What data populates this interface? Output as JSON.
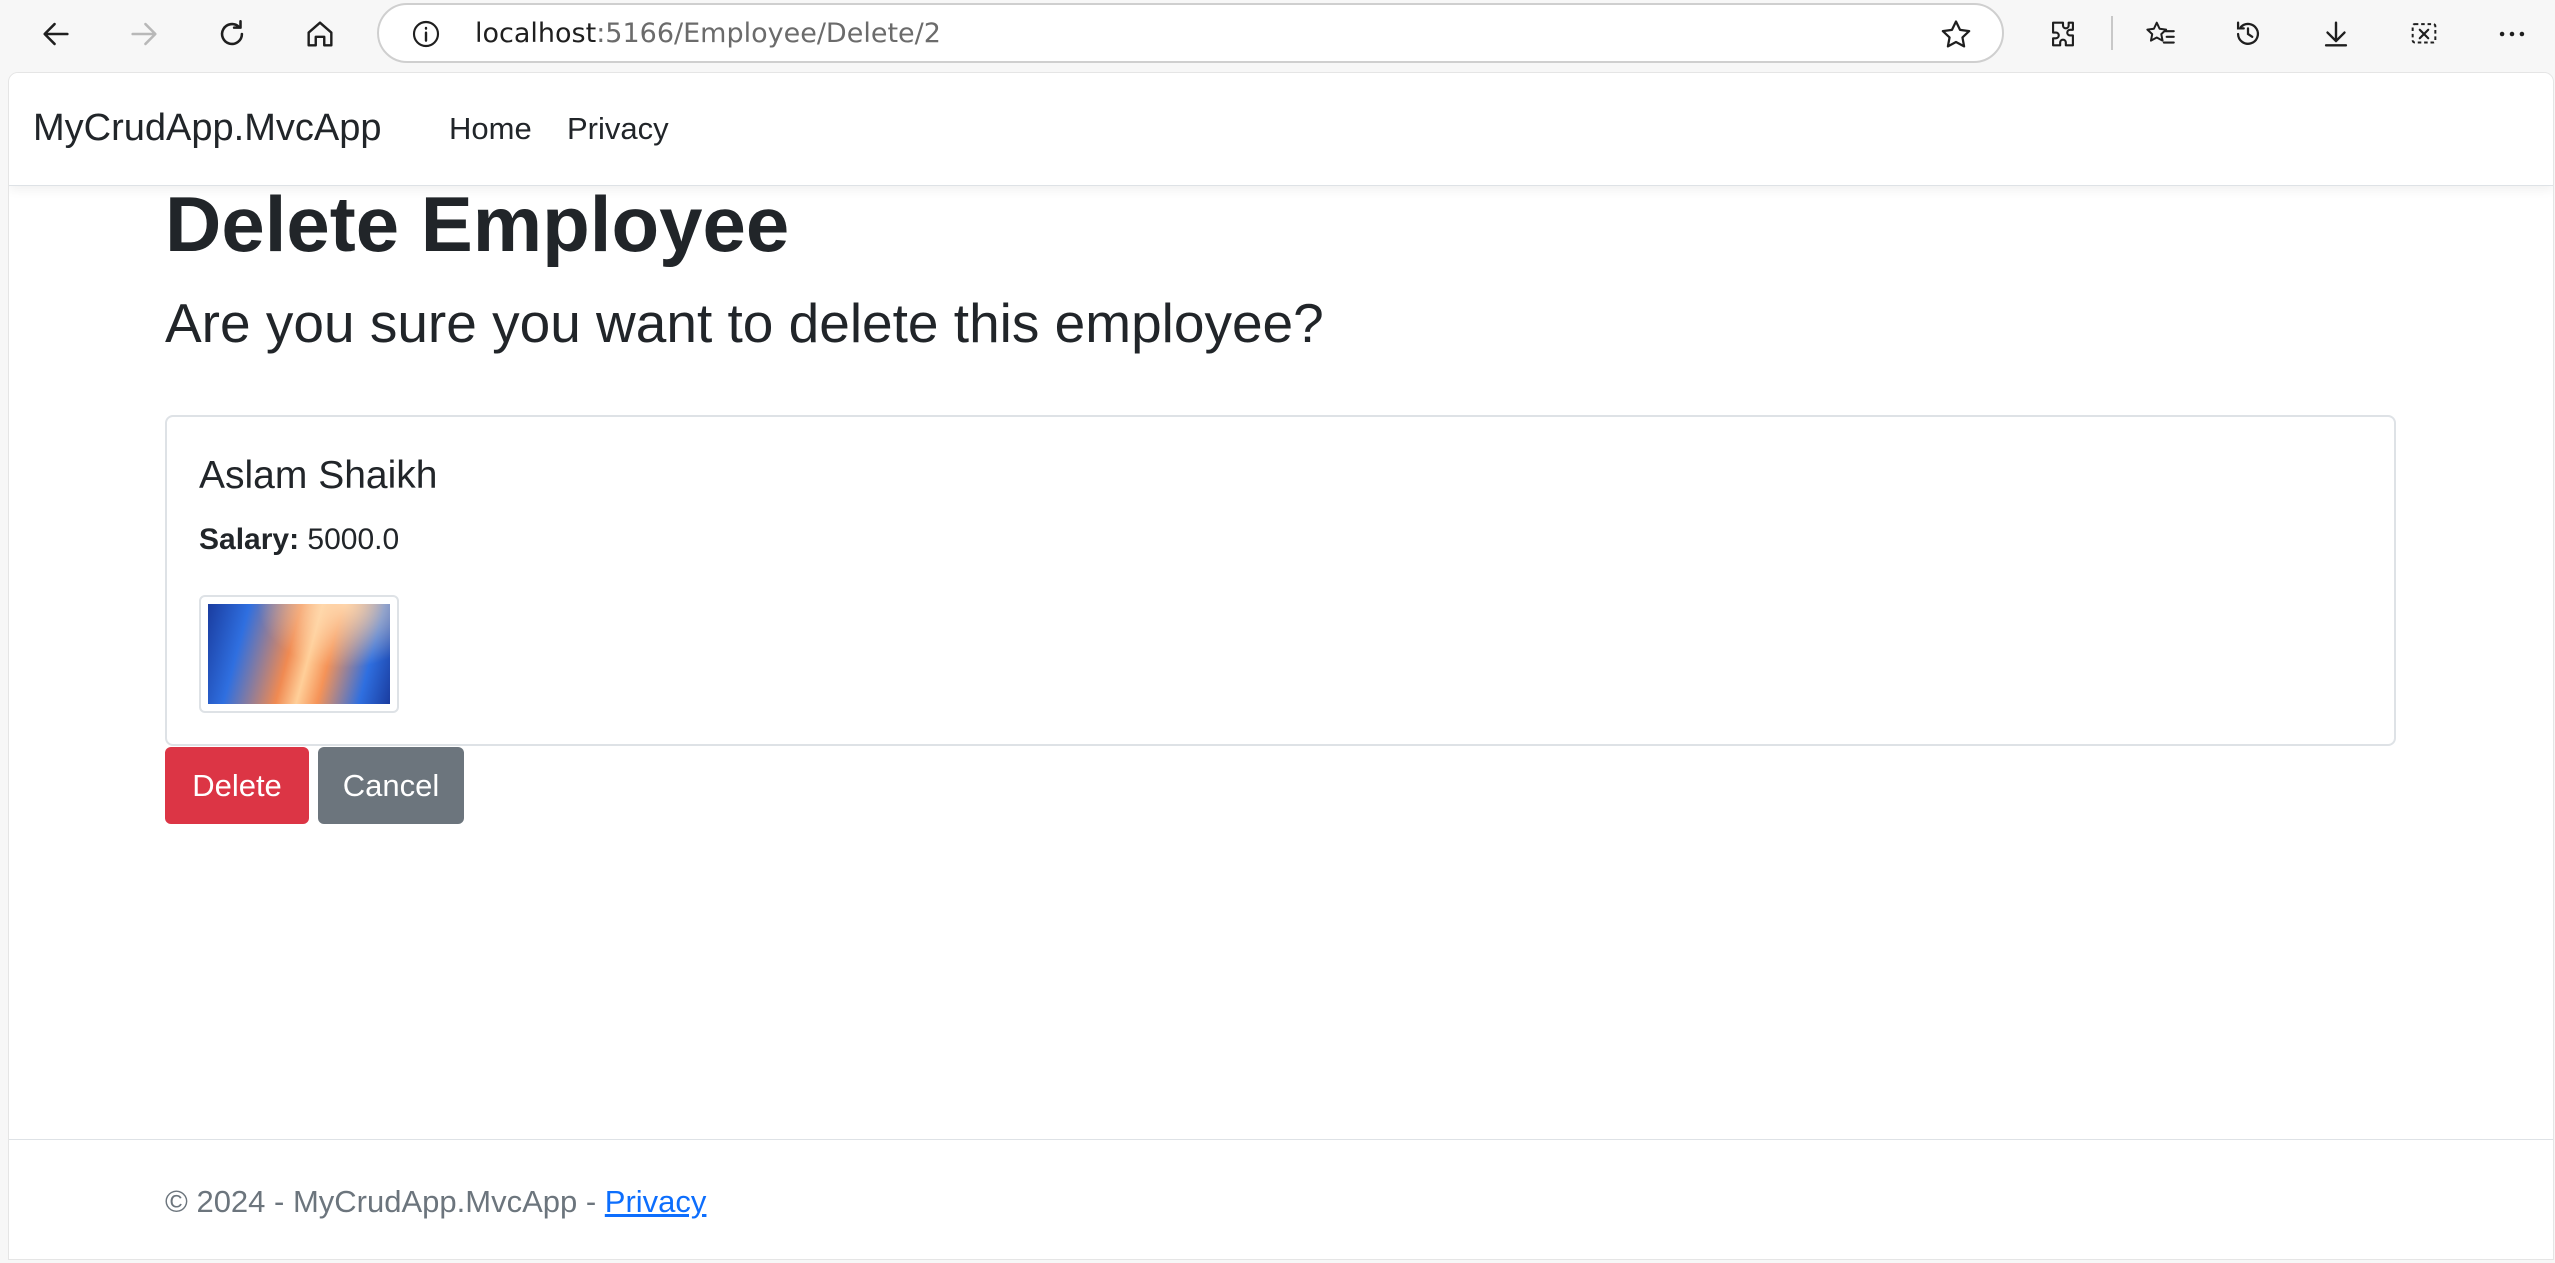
{
  "browser": {
    "url_host": "localhost",
    "url_path": ":5166/Employee/Delete/2"
  },
  "navbar": {
    "brand": "MyCrudApp.MvcApp",
    "links": [
      "Home",
      "Privacy"
    ]
  },
  "main": {
    "title": "Delete Employee",
    "subtitle": "Are you sure you want to delete this employee?",
    "employee": {
      "name": "Aslam Shaikh",
      "salary_label": "Salary:",
      "salary_value": "5000.0"
    },
    "buttons": {
      "delete": "Delete",
      "cancel": "Cancel"
    }
  },
  "footer": {
    "text": "© 2024 - MyCrudApp.MvcApp - ",
    "privacy_link": "Privacy"
  },
  "colors": {
    "danger": "#dc3545",
    "secondary": "#6c757d",
    "link": "#0d6efd"
  }
}
